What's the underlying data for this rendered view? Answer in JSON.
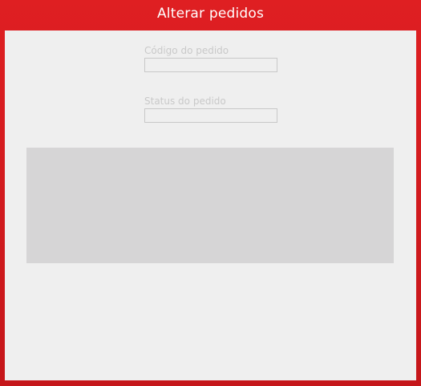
{
  "window": {
    "title": "Alterar pedidos"
  },
  "form": {
    "order_code_label": "Código do pedido",
    "order_code_value": "",
    "order_status_label": "Status do pedido",
    "order_status_value": ""
  },
  "colors": {
    "frame": "#d71a1d",
    "content_bg": "#efefef",
    "panel_bg": "#d6d5d6",
    "muted_text": "#c9c9c9"
  }
}
